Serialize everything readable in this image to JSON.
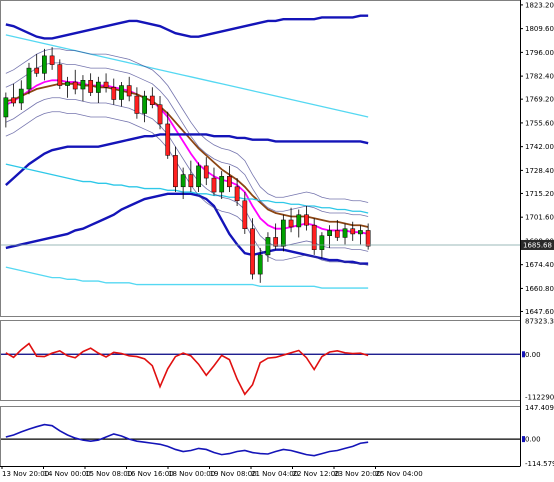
{
  "chart_data": {
    "type": "line",
    "instrument_chart": "candlestick",
    "main_panel": {
      "price_axis_ticks": [
        "1823.20",
        "1809.60",
        "1796.00",
        "1782.40",
        "1769.20",
        "1755.60",
        "1742.00",
        "1728.40",
        "1715.20",
        "1701.60",
        "1688.00",
        "1674.40",
        "1660.80",
        "1647.60"
      ],
      "current_price": "1685.68",
      "ylim": [
        1645.0,
        1826.0
      ],
      "candles": [
        [
          1759,
          1773,
          1753,
          1770
        ],
        [
          1770,
          1778,
          1765,
          1767
        ],
        [
          1767,
          1780,
          1763,
          1775
        ],
        [
          1775,
          1790,
          1772,
          1787
        ],
        [
          1787,
          1795,
          1782,
          1784
        ],
        [
          1784,
          1798,
          1780,
          1794
        ],
        [
          1794,
          1799,
          1786,
          1789
        ],
        [
          1789,
          1792,
          1775,
          1777
        ],
        [
          1777,
          1782,
          1770,
          1779
        ],
        [
          1779,
          1786,
          1772,
          1775
        ],
        [
          1775,
          1783,
          1768,
          1780
        ],
        [
          1780,
          1784,
          1771,
          1773
        ],
        [
          1773,
          1782,
          1767,
          1779
        ],
        [
          1779,
          1784,
          1773,
          1776
        ],
        [
          1776,
          1781,
          1766,
          1769
        ],
        [
          1769,
          1779,
          1765,
          1777
        ],
        [
          1777,
          1782,
          1768,
          1771
        ],
        [
          1771,
          1776,
          1758,
          1761
        ],
        [
          1761,
          1774,
          1756,
          1771
        ],
        [
          1771,
          1776,
          1764,
          1766
        ],
        [
          1766,
          1771,
          1752,
          1755
        ],
        [
          1755,
          1762,
          1735,
          1737
        ],
        [
          1737,
          1742,
          1716,
          1719
        ],
        [
          1719,
          1730,
          1712,
          1726
        ],
        [
          1726,
          1734,
          1716,
          1719
        ],
        [
          1719,
          1733,
          1716,
          1731
        ],
        [
          1731,
          1736,
          1720,
          1724
        ],
        [
          1724,
          1730,
          1714,
          1716
        ],
        [
          1716,
          1728,
          1712,
          1725
        ],
        [
          1725,
          1731,
          1716,
          1719
        ],
        [
          1719,
          1724,
          1708,
          1711
        ],
        [
          1711,
          1716,
          1692,
          1695
        ],
        [
          1695,
          1701,
          1666,
          1669
        ],
        [
          1669,
          1684,
          1664,
          1680
        ],
        [
          1680,
          1693,
          1676,
          1690
        ],
        [
          1690,
          1698,
          1683,
          1685
        ],
        [
          1685,
          1703,
          1682,
          1700
        ],
        [
          1700,
          1707,
          1693,
          1696
        ],
        [
          1696,
          1706,
          1690,
          1703
        ],
        [
          1703,
          1708,
          1694,
          1697
        ],
        [
          1697,
          1701,
          1680,
          1683
        ],
        [
          1683,
          1693,
          1678,
          1691
        ],
        [
          1691,
          1697,
          1684,
          1694
        ],
        [
          1694,
          1700,
          1688,
          1690
        ],
        [
          1690,
          1698,
          1686,
          1695
        ],
        [
          1695,
          1699,
          1688,
          1692
        ],
        [
          1692,
          1697,
          1686,
          1694
        ],
        [
          1694,
          1698,
          1683,
          1685
        ]
      ],
      "series": [
        {
          "color": "#ff00ff",
          "values": [
            1766,
            1768,
            1771,
            1774,
            1777,
            1779,
            1780,
            1780,
            1779,
            1779,
            1778,
            1777,
            1777,
            1777,
            1776,
            1775,
            1774,
            1772,
            1770,
            1768,
            1764,
            1759,
            1752,
            1745,
            1738,
            1732,
            1728,
            1725,
            1723,
            1722,
            1720,
            1716,
            1708,
            1701,
            1697,
            1695,
            1695,
            1696,
            1697,
            1698,
            1697,
            1695,
            1694,
            1694,
            1694,
            1693,
            1693,
            1692
          ]
        },
        {
          "color": "#8b4513",
          "values": [
            1768,
            1769,
            1771,
            1773,
            1775,
            1776,
            1777,
            1778,
            1778,
            1778,
            1777,
            1777,
            1776,
            1776,
            1775,
            1774,
            1773,
            1772,
            1770,
            1768,
            1765,
            1761,
            1756,
            1751,
            1746,
            1741,
            1737,
            1733,
            1729,
            1726,
            1723,
            1719,
            1714,
            1710,
            1706,
            1704,
            1703,
            1702,
            1702,
            1702,
            1701,
            1700,
            1699,
            1699,
            1698,
            1697,
            1697,
            1696
          ]
        },
        {
          "color": "#1414b8",
          "values": [
            1720,
            1724,
            1728,
            1732,
            1735,
            1738,
            1740,
            1741,
            1742,
            1742,
            1742,
            1742,
            1742,
            1743,
            1744,
            1745,
            1746,
            1747,
            1748,
            1748,
            1749,
            1749,
            1749,
            1749,
            1749,
            1749,
            1749,
            1748,
            1748,
            1748,
            1747,
            1747,
            1746,
            1746,
            1746,
            1745,
            1745,
            1745,
            1745,
            1745,
            1745,
            1745,
            1745,
            1745,
            1745,
            1745,
            1745,
            1744
          ]
        },
        {
          "color": "#1414b8",
          "values": [
            1812,
            1811,
            1809,
            1807,
            1805,
            1804,
            1804,
            1805,
            1806,
            1807,
            1808,
            1809,
            1810,
            1811,
            1812,
            1813,
            1814,
            1814,
            1813,
            1812,
            1811,
            1809,
            1807,
            1806,
            1805,
            1805,
            1806,
            1807,
            1808,
            1809,
            1810,
            1811,
            1812,
            1813,
            1814,
            1814,
            1815,
            1815,
            1815,
            1815,
            1815,
            1816,
            1816,
            1816,
            1816,
            1816,
            1817,
            1817
          ]
        },
        {
          "color": "#1414b8",
          "values": [
            1684,
            1685,
            1686,
            1687,
            1688,
            1689,
            1690,
            1691,
            1692,
            1694,
            1695,
            1697,
            1699,
            1701,
            1703,
            1706,
            1708,
            1710,
            1712,
            1713,
            1714,
            1715,
            1715,
            1715,
            1715,
            1714,
            1712,
            1708,
            1700,
            1692,
            1686,
            1681,
            1680,
            1681,
            1682,
            1683,
            1683,
            1682,
            1681,
            1680,
            1679,
            1678,
            1677,
            1677,
            1676,
            1676,
            1675,
            1675
          ]
        },
        {
          "color": "#2ec8e8",
          "values": [
            1732,
            1731,
            1730,
            1729,
            1728,
            1727,
            1726,
            1725,
            1724,
            1723,
            1722,
            1722,
            1721,
            1721,
            1720,
            1720,
            1719,
            1719,
            1718,
            1718,
            1718,
            1717,
            1717,
            1716,
            1716,
            1715,
            1715,
            1714,
            1714,
            1713,
            1713,
            1712,
            1712,
            1711,
            1711,
            1710,
            1710,
            1709,
            1709,
            1708,
            1708,
            1707,
            1707,
            1706,
            1706,
            1705,
            1705,
            1704
          ]
        },
        {
          "color": "#55d8f2",
          "values": [
            1806,
            1805,
            1804,
            1803,
            1802,
            1801,
            1800,
            1799,
            1798,
            1797,
            1796,
            1795,
            1794,
            1793,
            1792,
            1791,
            1790,
            1789,
            1788,
            1787,
            1786,
            1785,
            1784,
            1783,
            1782,
            1781,
            1780,
            1779,
            1778,
            1777,
            1776,
            1775,
            1774,
            1773,
            1772,
            1771,
            1770,
            1769,
            1768,
            1767,
            1766,
            1765,
            1764,
            1763,
            1762,
            1761,
            1760,
            1759
          ]
        },
        {
          "color": "#55d8f2",
          "values": [
            1673,
            1672,
            1671,
            1670,
            1669,
            1668,
            1667,
            1667,
            1666,
            1666,
            1665,
            1665,
            1665,
            1664,
            1664,
            1664,
            1664,
            1663,
            1663,
            1663,
            1663,
            1663,
            1663,
            1663,
            1663,
            1663,
            1663,
            1663,
            1663,
            1663,
            1663,
            1663,
            1663,
            1662,
            1662,
            1662,
            1662,
            1662,
            1662,
            1662,
            1662,
            1661,
            1661,
            1661,
            1661,
            1661,
            1661,
            1661
          ]
        }
      ]
    },
    "indicator_1": {
      "axis_ticks": [
        "87323.30",
        "0.00",
        "-112290."
      ],
      "ylim": [
        -120000,
        90000
      ],
      "zero_line_color": "#000080",
      "series": [
        {
          "color": "#e01010",
          "values": [
            4000,
            -8000,
            12000,
            28000,
            -5000,
            -6000,
            3000,
            9000,
            -4000,
            -9000,
            7000,
            16000,
            3000,
            -7000,
            5000,
            2000,
            -4000,
            -6000,
            -12000,
            -30000,
            -85000,
            -38000,
            -6000,
            3000,
            -4000,
            -26000,
            -55000,
            -30000,
            -3000,
            -14000,
            -65000,
            -105000,
            -80000,
            -22000,
            -10000,
            -8000,
            -2000,
            4000,
            10000,
            -9000,
            -40000,
            -6000,
            6000,
            9000,
            4000,
            2000,
            3000,
            -3000
          ]
        }
      ]
    },
    "indicator_2": {
      "axis_ticks": [
        "147.409",
        "0.00",
        "-114.579"
      ],
      "ylim": [
        -130,
        160
      ],
      "zero_line_color": "#000000",
      "series": [
        {
          "color": "#1414b8",
          "values": [
            10,
            20,
            35,
            48,
            60,
            70,
            65,
            40,
            20,
            5,
            -5,
            -10,
            -5,
            10,
            25,
            15,
            0,
            -10,
            -15,
            -20,
            -25,
            -35,
            -50,
            -60,
            -55,
            -45,
            -50,
            -65,
            -75,
            -70,
            -60,
            -55,
            -65,
            -70,
            -72,
            -60,
            -50,
            -55,
            -65,
            -75,
            -80,
            -70,
            -60,
            -55,
            -45,
            -35,
            -20,
            -15
          ]
        }
      ]
    },
    "time_axis_ticks": [
      "13 Nov 20:00",
      "14 Nov 00:00",
      "15 Nov 08:00",
      "16 Nov 16:00",
      "18 Nov 00:00",
      "19 Nov 08:00",
      "21 Nov 04:00",
      "22 Nov 12:00",
      "23 Nov 20:00",
      "25 Nov 04:00"
    ]
  }
}
